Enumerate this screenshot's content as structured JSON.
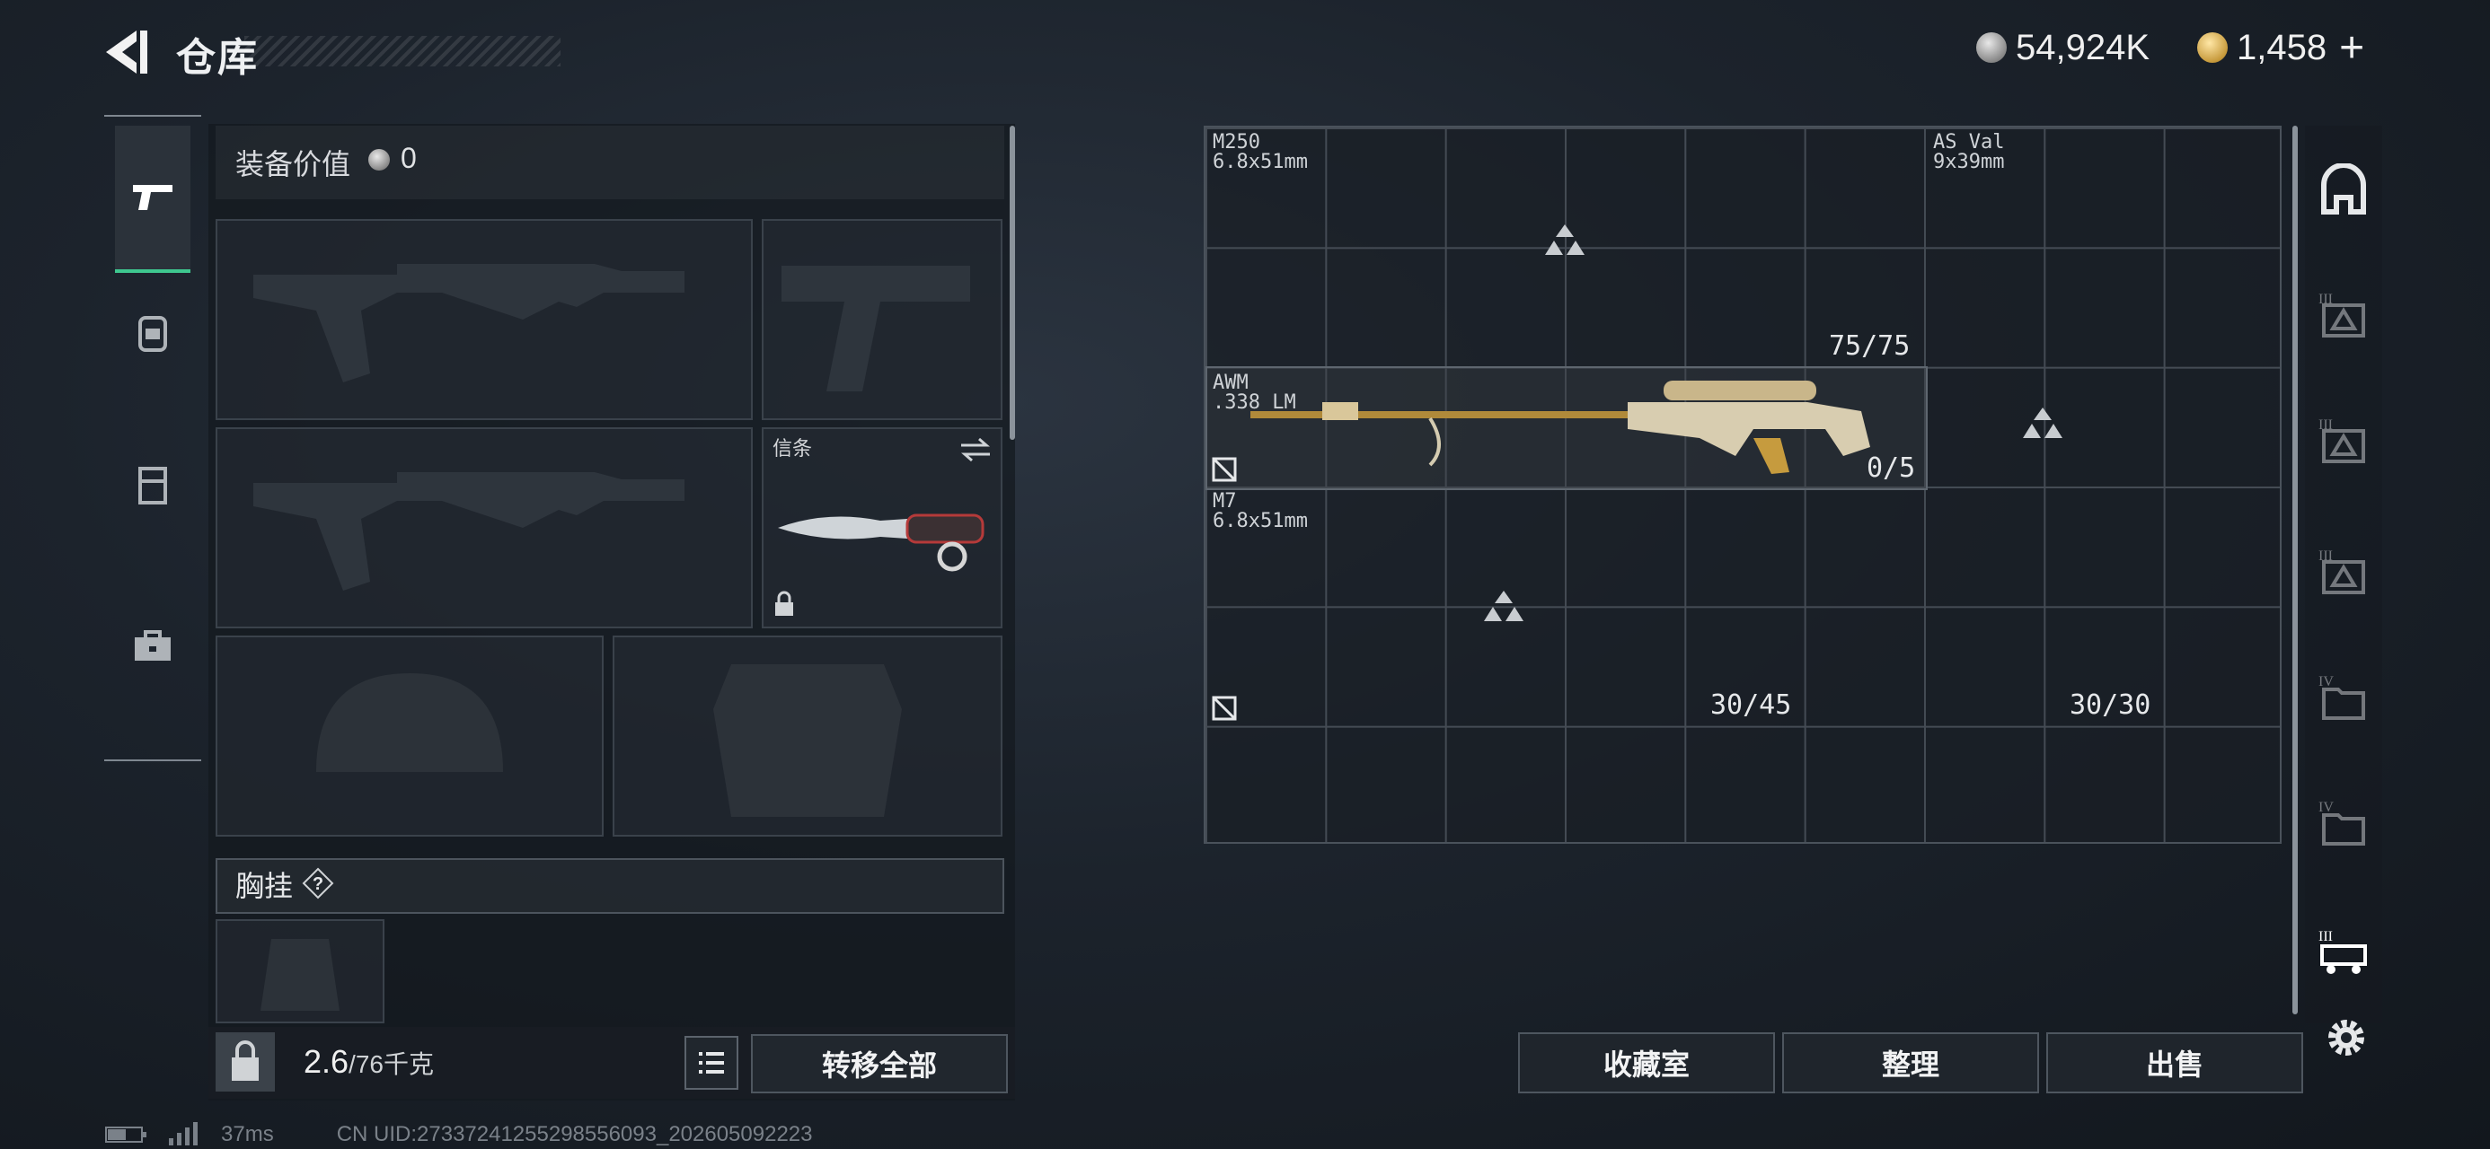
{
  "header": {
    "title": "仓库",
    "currency_silver": "54,924K",
    "currency_gold": "1,458",
    "plus": "+"
  },
  "left_panel": {
    "equip_value_label": "装备价值",
    "equip_value": "0",
    "melee_slot_label": "信条",
    "chest_rig_label": "胸挂",
    "chest_help": "?",
    "weight_current": "2.6",
    "weight_capacity": "/76千克",
    "transfer_all": "转移全部"
  },
  "grid": {
    "weapons": [
      {
        "name": "M250",
        "caliber": "6.8x51mm",
        "ammo": "75/75"
      },
      {
        "name": "AS Val",
        "caliber": "9x39mm",
        "ammo": ""
      },
      {
        "name": "AWM",
        "caliber": ".338 LM",
        "ammo": "0/5"
      },
      {
        "name": "M7",
        "caliber": "6.8x51mm",
        "ammo": "30/45"
      },
      {
        "name": "",
        "caliber": "",
        "ammo": "30/30"
      }
    ]
  },
  "right_buttons": {
    "collection": "收藏室",
    "sort": "整理",
    "sell": "出售"
  },
  "right_nav": [
    {
      "icon": "backpack-icon"
    },
    {
      "icon": "tier-3-crate-icon",
      "roman": "III"
    },
    {
      "icon": "tier-3-crate-icon",
      "roman": "III"
    },
    {
      "icon": "tier-3-crate-icon",
      "roman": "III"
    },
    {
      "icon": "tier-4-folder-icon",
      "roman": "IV"
    },
    {
      "icon": "tier-4-folder-icon",
      "roman": "IV"
    },
    {
      "icon": "tier-3-vehicle-icon",
      "roman": "III"
    }
  ],
  "status": {
    "ping": "37ms",
    "uid": "CN UID:27337241255298556093_202605092223"
  },
  "colors": {
    "accent_green": "#3ec78f",
    "background": "#1c232c"
  }
}
